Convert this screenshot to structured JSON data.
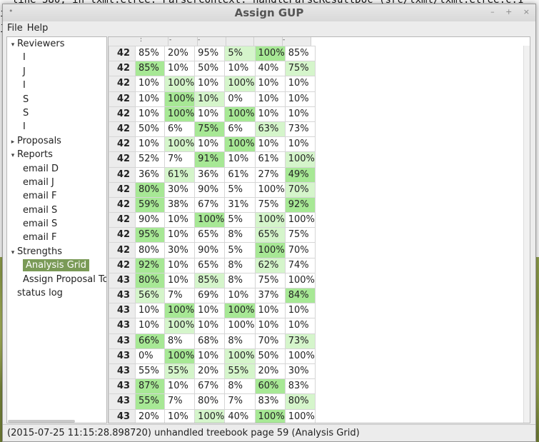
{
  "window": {
    "title": "Assign GUP",
    "controls": [
      "–",
      "+",
      "×"
    ]
  },
  "menu": {
    "items": [
      "File",
      "Help"
    ]
  },
  "tree": {
    "rows": [
      {
        "label": "Reviewers",
        "level": 0,
        "arrow": "▾",
        "selected": false
      },
      {
        "label": "I",
        "level": 1,
        "arrow": "",
        "selected": false
      },
      {
        "label": "J",
        "level": 1,
        "arrow": "",
        "selected": false
      },
      {
        "label": "I",
        "level": 1,
        "arrow": "",
        "selected": false
      },
      {
        "label": "S",
        "level": 1,
        "arrow": "",
        "selected": false
      },
      {
        "label": "S",
        "level": 1,
        "arrow": "",
        "selected": false
      },
      {
        "label": "I",
        "level": 1,
        "arrow": "",
        "selected": false
      },
      {
        "label": "Proposals",
        "level": 0,
        "arrow": "▸",
        "selected": false
      },
      {
        "label": "Reports",
        "level": 0,
        "arrow": "▾",
        "selected": false
      },
      {
        "label": "email D",
        "level": 1,
        "arrow": "",
        "selected": false
      },
      {
        "label": "email J",
        "level": 1,
        "arrow": "",
        "selected": false
      },
      {
        "label": "email F",
        "level": 1,
        "arrow": "",
        "selected": false
      },
      {
        "label": "email S",
        "level": 1,
        "arrow": "",
        "selected": false
      },
      {
        "label": "email S",
        "level": 1,
        "arrow": "",
        "selected": false
      },
      {
        "label": "email F",
        "level": 1,
        "arrow": "",
        "selected": false
      },
      {
        "label": "Strengths",
        "level": 0,
        "arrow": "▾",
        "selected": false
      },
      {
        "label": "Analysis Grid",
        "level": 1,
        "arrow": "",
        "selected": true
      },
      {
        "label": "Assign Proposal Topics",
        "level": 1,
        "arrow": "",
        "selected": false
      },
      {
        "label": "status log",
        "level": 0,
        "arrow": "",
        "selected": false
      }
    ]
  },
  "grid": {
    "header_marks": [
      ":",
      "-",
      "-",
      "",
      "",
      "-"
    ],
    "rows": [
      {
        "label": "42",
        "cells": [
          [
            "85%",
            ""
          ],
          [
            "20%",
            ""
          ],
          [
            "95%",
            ""
          ],
          [
            "5%",
            "light"
          ],
          [
            "100%",
            "dark"
          ],
          [
            "85%",
            ""
          ]
        ]
      },
      {
        "label": "42",
        "cells": [
          [
            "85%",
            "dark"
          ],
          [
            "10%",
            ""
          ],
          [
            "50%",
            ""
          ],
          [
            "10%",
            ""
          ],
          [
            "40%",
            ""
          ],
          [
            "75%",
            "light"
          ]
        ]
      },
      {
        "label": "42",
        "cells": [
          [
            "10%",
            ""
          ],
          [
            "100%",
            "light"
          ],
          [
            "10%",
            ""
          ],
          [
            "100%",
            "light"
          ],
          [
            "10%",
            ""
          ],
          [
            "10%",
            ""
          ]
        ]
      },
      {
        "label": "42",
        "cells": [
          [
            "10%",
            ""
          ],
          [
            "100%",
            "dark"
          ],
          [
            "10%",
            "light"
          ],
          [
            "0%",
            ""
          ],
          [
            "10%",
            ""
          ],
          [
            "10%",
            ""
          ]
        ]
      },
      {
        "label": "42",
        "cells": [
          [
            "10%",
            ""
          ],
          [
            "100%",
            "dark"
          ],
          [
            "10%",
            ""
          ],
          [
            "100%",
            "dark"
          ],
          [
            "10%",
            ""
          ],
          [
            "10%",
            ""
          ]
        ]
      },
      {
        "label": "42",
        "cells": [
          [
            "50%",
            ""
          ],
          [
            "6%",
            ""
          ],
          [
            "75%",
            "dark"
          ],
          [
            "6%",
            ""
          ],
          [
            "63%",
            "light"
          ],
          [
            "73%",
            ""
          ]
        ]
      },
      {
        "label": "42",
        "cells": [
          [
            "10%",
            ""
          ],
          [
            "100%",
            "light"
          ],
          [
            "10%",
            ""
          ],
          [
            "100%",
            "dark"
          ],
          [
            "10%",
            ""
          ],
          [
            "10%",
            ""
          ]
        ]
      },
      {
        "label": "42",
        "cells": [
          [
            "52%",
            ""
          ],
          [
            "7%",
            ""
          ],
          [
            "91%",
            "dark"
          ],
          [
            "10%",
            ""
          ],
          [
            "61%",
            ""
          ],
          [
            "100%",
            "light"
          ]
        ]
      },
      {
        "label": "42",
        "cells": [
          [
            "36%",
            ""
          ],
          [
            "61%",
            "light"
          ],
          [
            "36%",
            ""
          ],
          [
            "61%",
            ""
          ],
          [
            "27%",
            ""
          ],
          [
            "49%",
            "dark"
          ]
        ]
      },
      {
        "label": "42",
        "cells": [
          [
            "80%",
            "dark"
          ],
          [
            "30%",
            ""
          ],
          [
            "90%",
            ""
          ],
          [
            "5%",
            ""
          ],
          [
            "100%",
            ""
          ],
          [
            "70%",
            "light"
          ]
        ]
      },
      {
        "label": "42",
        "cells": [
          [
            "59%",
            "dark"
          ],
          [
            "38%",
            ""
          ],
          [
            "67%",
            ""
          ],
          [
            "31%",
            ""
          ],
          [
            "75%",
            ""
          ],
          [
            "92%",
            "dark"
          ]
        ]
      },
      {
        "label": "42",
        "cells": [
          [
            "90%",
            ""
          ],
          [
            "10%",
            ""
          ],
          [
            "100%",
            "dark"
          ],
          [
            "5%",
            ""
          ],
          [
            "100%",
            "light"
          ],
          [
            "100%",
            ""
          ]
        ]
      },
      {
        "label": "42",
        "cells": [
          [
            "95%",
            "dark"
          ],
          [
            "10%",
            ""
          ],
          [
            "65%",
            ""
          ],
          [
            "8%",
            ""
          ],
          [
            "65%",
            "light"
          ],
          [
            "75%",
            ""
          ]
        ]
      },
      {
        "label": "42",
        "cells": [
          [
            "80%",
            ""
          ],
          [
            "30%",
            ""
          ],
          [
            "90%",
            ""
          ],
          [
            "5%",
            ""
          ],
          [
            "100%",
            "dark"
          ],
          [
            "70%",
            ""
          ]
        ]
      },
      {
        "label": "42",
        "cells": [
          [
            "92%",
            "dark"
          ],
          [
            "10%",
            ""
          ],
          [
            "65%",
            ""
          ],
          [
            "8%",
            ""
          ],
          [
            "62%",
            "light"
          ],
          [
            "74%",
            ""
          ]
        ]
      },
      {
        "label": "43",
        "cells": [
          [
            "80%",
            "dark"
          ],
          [
            "10%",
            ""
          ],
          [
            "85%",
            "light"
          ],
          [
            "8%",
            ""
          ],
          [
            "75%",
            ""
          ],
          [
            "100%",
            ""
          ]
        ]
      },
      {
        "label": "43",
        "cells": [
          [
            "56%",
            "light"
          ],
          [
            "7%",
            ""
          ],
          [
            "69%",
            ""
          ],
          [
            "10%",
            ""
          ],
          [
            "37%",
            ""
          ],
          [
            "84%",
            "dark"
          ]
        ]
      },
      {
        "label": "43",
        "cells": [
          [
            "10%",
            ""
          ],
          [
            "100%",
            "dark"
          ],
          [
            "10%",
            ""
          ],
          [
            "100%",
            "dark"
          ],
          [
            "10%",
            ""
          ],
          [
            "10%",
            ""
          ]
        ]
      },
      {
        "label": "43",
        "cells": [
          [
            "10%",
            ""
          ],
          [
            "100%",
            "light"
          ],
          [
            "10%",
            ""
          ],
          [
            "100%",
            ""
          ],
          [
            "10%",
            ""
          ],
          [
            "10%",
            ""
          ]
        ]
      },
      {
        "label": "43",
        "cells": [
          [
            "66%",
            "dark"
          ],
          [
            "8%",
            ""
          ],
          [
            "68%",
            ""
          ],
          [
            "8%",
            ""
          ],
          [
            "70%",
            ""
          ],
          [
            "73%",
            "light"
          ]
        ]
      },
      {
        "label": "43",
        "cells": [
          [
            "0%",
            ""
          ],
          [
            "100%",
            "dark"
          ],
          [
            "10%",
            ""
          ],
          [
            "100%",
            "light"
          ],
          [
            "50%",
            ""
          ],
          [
            "100%",
            ""
          ]
        ]
      },
      {
        "label": "43",
        "cells": [
          [
            "55%",
            ""
          ],
          [
            "55%",
            "light"
          ],
          [
            "20%",
            ""
          ],
          [
            "55%",
            "light"
          ],
          [
            "20%",
            ""
          ],
          [
            "30%",
            ""
          ]
        ]
      },
      {
        "label": "43",
        "cells": [
          [
            "87%",
            "dark"
          ],
          [
            "10%",
            ""
          ],
          [
            "67%",
            ""
          ],
          [
            "8%",
            ""
          ],
          [
            "60%",
            "dark"
          ],
          [
            "83%",
            ""
          ]
        ]
      },
      {
        "label": "43",
        "cells": [
          [
            "55%",
            "dark"
          ],
          [
            "7%",
            ""
          ],
          [
            "80%",
            ""
          ],
          [
            "7%",
            ""
          ],
          [
            "83%",
            ""
          ],
          [
            "80%",
            "light"
          ]
        ]
      },
      {
        "label": "43",
        "cells": [
          [
            "20%",
            ""
          ],
          [
            "10%",
            ""
          ],
          [
            "100%",
            "light"
          ],
          [
            "40%",
            ""
          ],
          [
            "100%",
            "dark"
          ],
          [
            "100%",
            ""
          ]
        ]
      }
    ]
  },
  "status": {
    "text": "(2015-07-25 11:15:28.898720) unhandled treebook page 59 (Analysis Grid)"
  },
  "background": {
    "terminal_lines": [
      "  line 580, in lxml.etree._ParserContext._handleParseResultDoc (src/lxml/lxml.etree.c:1",
      "i",
      "j"
    ]
  },
  "colors": {
    "cell_dark": "#a7e895",
    "cell_light": "#d5f5cb",
    "selection": "#7a9a57"
  }
}
